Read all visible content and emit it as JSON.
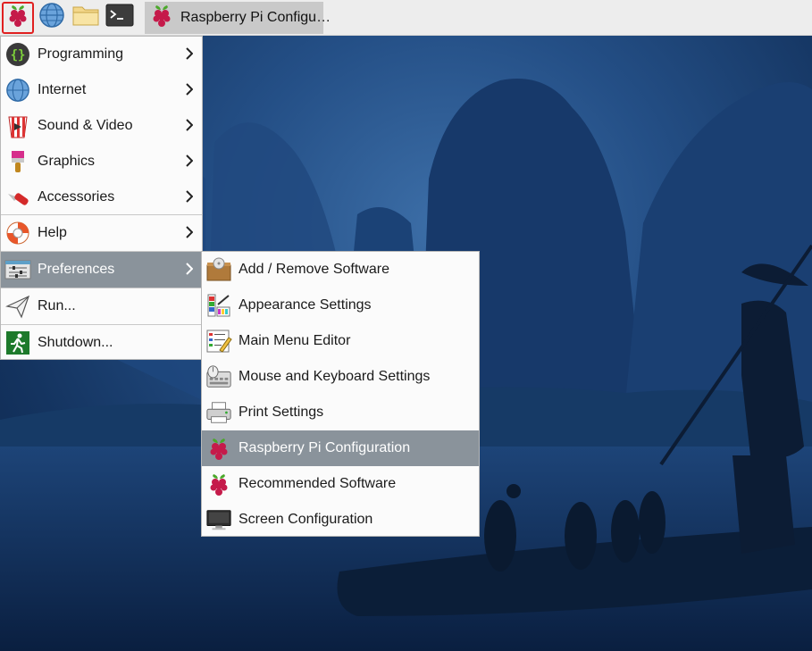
{
  "taskbar": {
    "launchers": [
      {
        "name": "raspberry-menu",
        "icon": "raspberry-icon"
      },
      {
        "name": "web-browser",
        "icon": "globe-icon"
      },
      {
        "name": "file-manager",
        "icon": "folder-icon"
      },
      {
        "name": "terminal",
        "icon": "terminal-icon"
      }
    ],
    "active_window": {
      "label": "Raspberry Pi Configu…",
      "icon": "raspberry-icon"
    }
  },
  "main_menu": {
    "items": [
      {
        "label": "Programming",
        "icon": "code-braces-icon",
        "submenu": true
      },
      {
        "label": "Internet",
        "icon": "globe-icon",
        "submenu": true
      },
      {
        "label": "Sound & Video",
        "icon": "popcorn-play-icon",
        "submenu": true
      },
      {
        "label": "Graphics",
        "icon": "paintbrush-icon",
        "submenu": true
      },
      {
        "label": "Accessories",
        "icon": "multitool-icon",
        "submenu": true
      },
      {
        "label": "Help",
        "icon": "lifebuoy-icon",
        "submenu": true
      },
      {
        "label": "Preferences",
        "icon": "sliders-icon",
        "submenu": true,
        "active": true
      },
      {
        "label": "Run...",
        "icon": "paper-plane-icon",
        "submenu": false
      },
      {
        "label": "Shutdown...",
        "icon": "exit-icon",
        "submenu": false
      }
    ]
  },
  "preferences_menu": {
    "items": [
      {
        "label": "Add / Remove Software",
        "icon": "package-icon"
      },
      {
        "label": "Appearance Settings",
        "icon": "palette-icon"
      },
      {
        "label": "Main Menu Editor",
        "icon": "menu-edit-icon"
      },
      {
        "label": "Mouse and Keyboard Settings",
        "icon": "mouse-keyboard-icon"
      },
      {
        "label": "Print Settings",
        "icon": "printer-icon"
      },
      {
        "label": "Raspberry Pi Configuration",
        "icon": "raspberry-icon",
        "active": true
      },
      {
        "label": "Recommended Software",
        "icon": "raspberry-icon"
      },
      {
        "label": "Screen Configuration",
        "icon": "monitor-icon"
      }
    ]
  },
  "colors": {
    "menu_highlight": "#8a939b",
    "taskbar_bg": "#ededed",
    "raspberry_red": "#c51a4a",
    "raspberry_green": "#4aa82a"
  }
}
